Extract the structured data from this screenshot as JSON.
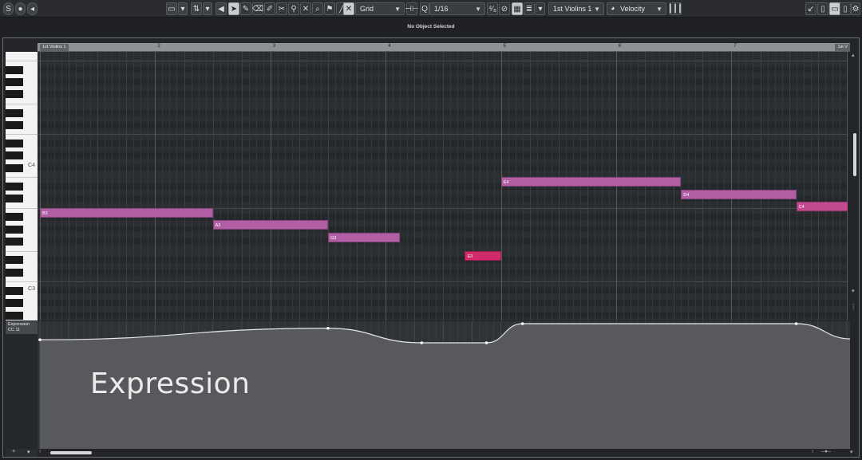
{
  "toolbar": {
    "snap_type": "Grid",
    "quantize": "1/16",
    "track": "1st Violins 1",
    "event_lane": "Velocity",
    "colors": {
      "accent": "#2f9cff",
      "active_tool": "#d9dde1"
    }
  },
  "status": {
    "info_line": "No Object Selected"
  },
  "ruler": {
    "part_name": "1st Violins 1",
    "part_name_end": "1st V",
    "bars": [
      "2",
      "3",
      "4",
      "5",
      "6",
      "7"
    ]
  },
  "keyboard": {
    "labels": [
      "C4",
      "C3"
    ]
  },
  "notes": [
    {
      "pitch": "B3",
      "start_beat": 1.0,
      "length_beats": 6.0,
      "color": "#b15ea5"
    },
    {
      "pitch": "A3",
      "start_beat": 7.0,
      "length_beats": 4.0,
      "color": "#b15ea5"
    },
    {
      "pitch": "G3",
      "start_beat": 11.0,
      "length_beats": 2.5,
      "color": "#b15ea5"
    },
    {
      "pitch": "E3",
      "start_beat": 15.75,
      "length_beats": 1.25,
      "color": "#d02a6a"
    },
    {
      "pitch": "E4",
      "start_beat": 17.0,
      "length_beats": 6.25,
      "color": "#b15ea5"
    },
    {
      "pitch": "D4",
      "start_beat": 23.25,
      "length_beats": 4.0,
      "color": "#b15ea5"
    },
    {
      "pitch": "C4",
      "start_beat": 27.25,
      "length_beats": 2.0,
      "color": "#c24a8f"
    }
  ],
  "controller_lane": {
    "name_line1": "Expression",
    "name_line2": "CC 11",
    "overlay_label": "Expression",
    "points": [
      {
        "beat": 1.0,
        "value": 0.79
      },
      {
        "beat": 11.0,
        "value": 0.94
      },
      {
        "beat": 14.25,
        "value": 0.75
      },
      {
        "beat": 16.5,
        "value": 0.75
      },
      {
        "beat": 17.75,
        "value": 1.0
      },
      {
        "beat": 27.25,
        "value": 1.0
      },
      {
        "beat": 29.2,
        "value": 0.8
      }
    ]
  }
}
